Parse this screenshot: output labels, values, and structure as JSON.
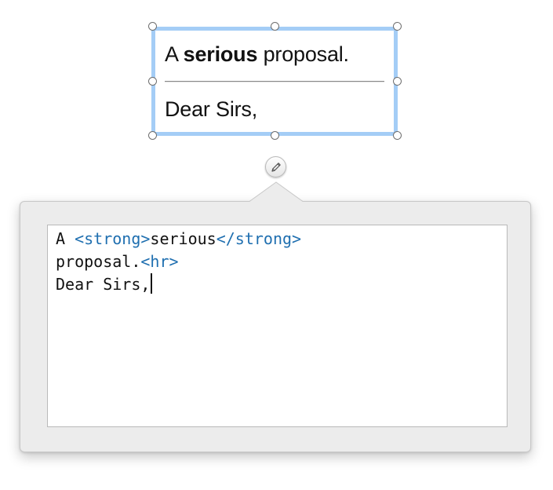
{
  "preview": {
    "line1_before": "A ",
    "line1_bold": "serious",
    "line1_after": " proposal.",
    "line2": "Dear Sirs,"
  },
  "edit_button": {
    "icon": "pencil-icon"
  },
  "editor": {
    "line1": {
      "text_a": "A ",
      "tag_open": "<strong>",
      "text_b": "serious",
      "tag_close": "</strong>"
    },
    "line2": {
      "text": "proposal.",
      "tag": "<hr>"
    },
    "line3": {
      "text": "Dear Sirs,"
    }
  },
  "colors": {
    "selection_border": "#a4cdf6",
    "tag_color": "#1f6fb0",
    "popover_background": "#ececec"
  }
}
